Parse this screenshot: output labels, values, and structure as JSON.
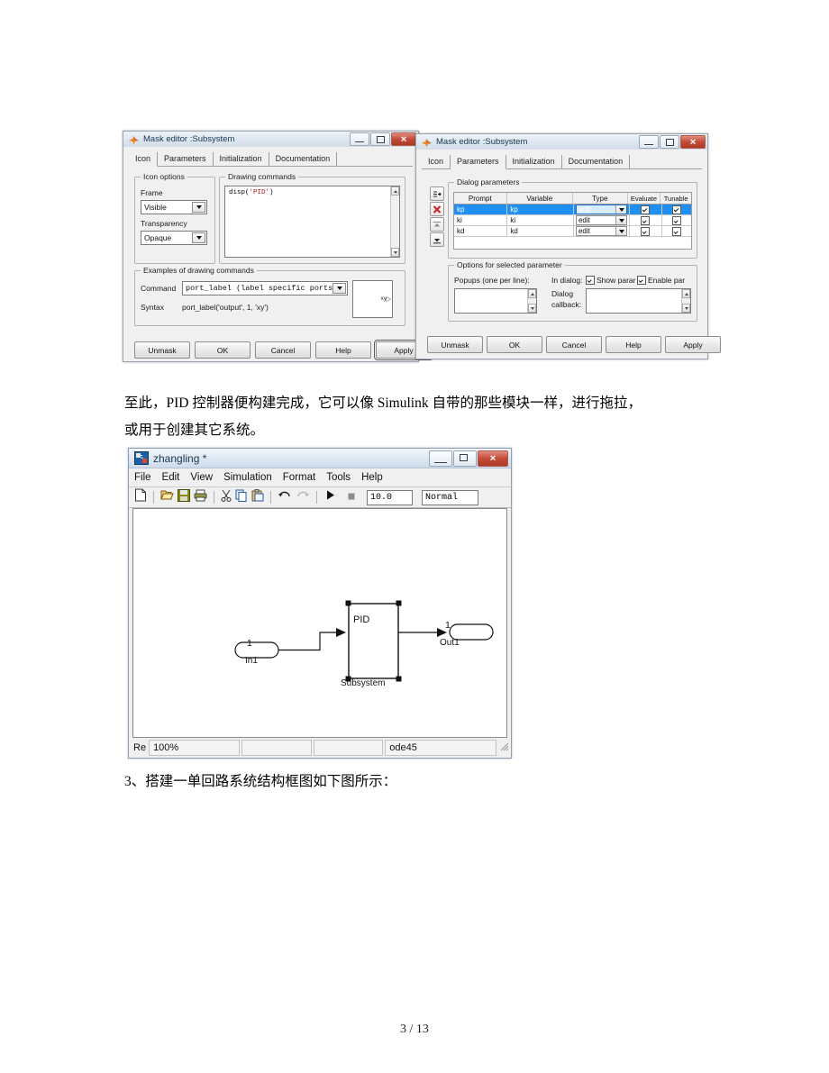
{
  "document": {
    "paragraph1": "至此，PID 控制器便构建完成，它可以像 Simulink 自带的那些模块一样，进行拖拉，",
    "paragraph2": "或用于创建其它系统。",
    "paragraph3": "3、搭建一单回路系统结构框图如下图所示：",
    "footer": "3  / 13"
  },
  "mask_editor_icon": {
    "title": "Mask editor :Subsystem",
    "tabs": [
      {
        "label": "Icon",
        "selected": true
      },
      {
        "label": "Parameters",
        "selected": false
      },
      {
        "label": "Initialization",
        "selected": false
      },
      {
        "label": "Documentation",
        "selected": false
      }
    ],
    "icon_options": {
      "legend": "Icon options",
      "frame_label": "Frame",
      "frame_value": "Visible",
      "transparency_label": "Transparency",
      "transparency_value": "Opaque"
    },
    "drawing_commands": {
      "legend": "Drawing commands",
      "code_fn": "disp",
      "code_open": "(",
      "code_arg": "'PID'",
      "code_close": ")"
    },
    "examples": {
      "legend": "Examples of drawing commands",
      "command_label": "Command",
      "command_value": "port_label (label specific ports)",
      "syntax_label": "Syntax",
      "syntax_value": "port_label('output', 1, 'xy')",
      "preview_text": "xy"
    },
    "buttons": [
      {
        "label": "Unmask",
        "focused": false
      },
      {
        "label": "OK",
        "focused": false
      },
      {
        "label": "Cancel",
        "focused": false
      },
      {
        "label": "Help",
        "focused": false
      },
      {
        "label": "Apply",
        "focused": true
      }
    ]
  },
  "mask_editor_params": {
    "title": "Mask editor :Subsystem",
    "tabs": [
      {
        "label": "Icon",
        "selected": false
      },
      {
        "label": "Parameters",
        "selected": true
      },
      {
        "label": "Initialization",
        "selected": false
      },
      {
        "label": "Documentation",
        "selected": false
      }
    ],
    "dialog_parameters": {
      "legend": "Dialog parameters",
      "columns": [
        "Prompt",
        "Variable",
        "Type",
        "Evaluate",
        "Tunable"
      ],
      "rows": [
        {
          "prompt": "kp",
          "variable": "kp",
          "type": "edit",
          "evaluate": true,
          "tunable": true,
          "selected": true
        },
        {
          "prompt": "ki",
          "variable": "ki",
          "type": "edit",
          "evaluate": true,
          "tunable": true,
          "selected": false
        },
        {
          "prompt": "kd",
          "variable": "kd",
          "type": "edit",
          "evaluate": true,
          "tunable": true,
          "selected": false
        }
      ]
    },
    "options": {
      "legend": "Options for selected parameter",
      "popups_label": "Popups (one per line):",
      "popups_value": "",
      "in_dialog_label": "In dialog:",
      "show_param_label": "Show parar",
      "show_param_checked": true,
      "enable_param_label": "Enable par",
      "enable_param_checked": true,
      "dialog_callback_label1": "Dialog",
      "dialog_callback_label2": "callback:",
      "dialog_callback_value": ""
    },
    "buttons": [
      {
        "label": "Unmask",
        "focused": false
      },
      {
        "label": "OK",
        "focused": false
      },
      {
        "label": "Cancel",
        "focused": false
      },
      {
        "label": "Help",
        "focused": false
      },
      {
        "label": "Apply",
        "focused": false
      }
    ]
  },
  "simulink": {
    "title": "zhangling *",
    "menu": [
      "File",
      "Edit",
      "View",
      "Simulation",
      "Format",
      "Tools",
      "Help"
    ],
    "toolbar": {
      "stop_time": "10.0",
      "sim_mode": "Normal"
    },
    "diagram": {
      "input_port_number": "1",
      "input_label": "In1",
      "block_text": "PID",
      "block_label": "Subsystem",
      "output_port_number": "1",
      "output_label": "Out1"
    },
    "status": {
      "ready": "Re",
      "zoom": "100%",
      "cell3": "",
      "cell4": "",
      "solver": "ode45"
    }
  }
}
